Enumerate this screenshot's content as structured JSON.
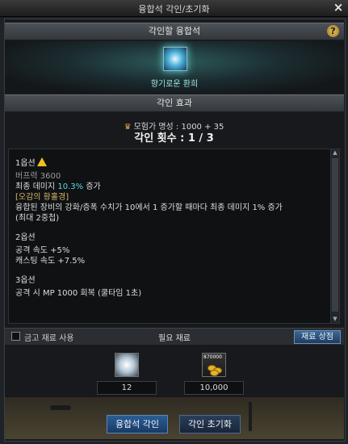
{
  "window": {
    "title": "융합석 각인/초기화",
    "close_label": "×"
  },
  "header": {
    "title": "각인할 융합석",
    "help_label": "?"
  },
  "hero": {
    "item_name": "향기로운 환희"
  },
  "effects": {
    "section_title": "각인 효과",
    "fame_label": "모험가 명성 : 1000 + 35",
    "count_label": "각인 횟수 : 1 / 3"
  },
  "options": [
    {
      "title": "1옵션",
      "lines": [
        {
          "text": "버프력 3600",
          "color": "gray"
        },
        {
          "text": "최종 데미지 10.3% 증가",
          "color": "white"
        },
        {
          "text": "[오감의 황홀경]",
          "color": "gold"
        },
        {
          "text": "융합된 장비의 강화/증폭 수치가 10에서 1 증가할 때마다 최종 데미지 1% 증가",
          "color": "white"
        },
        {
          "text": "(최대 2중첩)",
          "color": "white"
        }
      ]
    },
    {
      "title": "2옵션",
      "lines": [
        {
          "text": "공격 속도 +5%",
          "color": "white"
        },
        {
          "text": "캐스팅 속도 +7.5%",
          "color": "white"
        }
      ]
    },
    {
      "title": "3옵션",
      "lines": [
        {
          "text": "공격 시 MP 1000 회복 (쿨타임 1초)",
          "color": "white"
        }
      ]
    }
  ],
  "materials": {
    "use_vault_label": "금고 재료 사용",
    "title": "필요 재료",
    "shop_label": "재료 상점",
    "items": [
      {
        "name": "fusion-material-icon",
        "quantity": "12"
      },
      {
        "name": "gold-coins-icon",
        "icon_text": "870000",
        "quantity": "10,000"
      }
    ]
  },
  "actions": {
    "engrave_label": "융합석 각인",
    "reset_label": "각인 초기화"
  },
  "colors": {
    "accent": "#2b5d95",
    "cyan": "#5ad7e8",
    "gold": "#d4b46a"
  }
}
